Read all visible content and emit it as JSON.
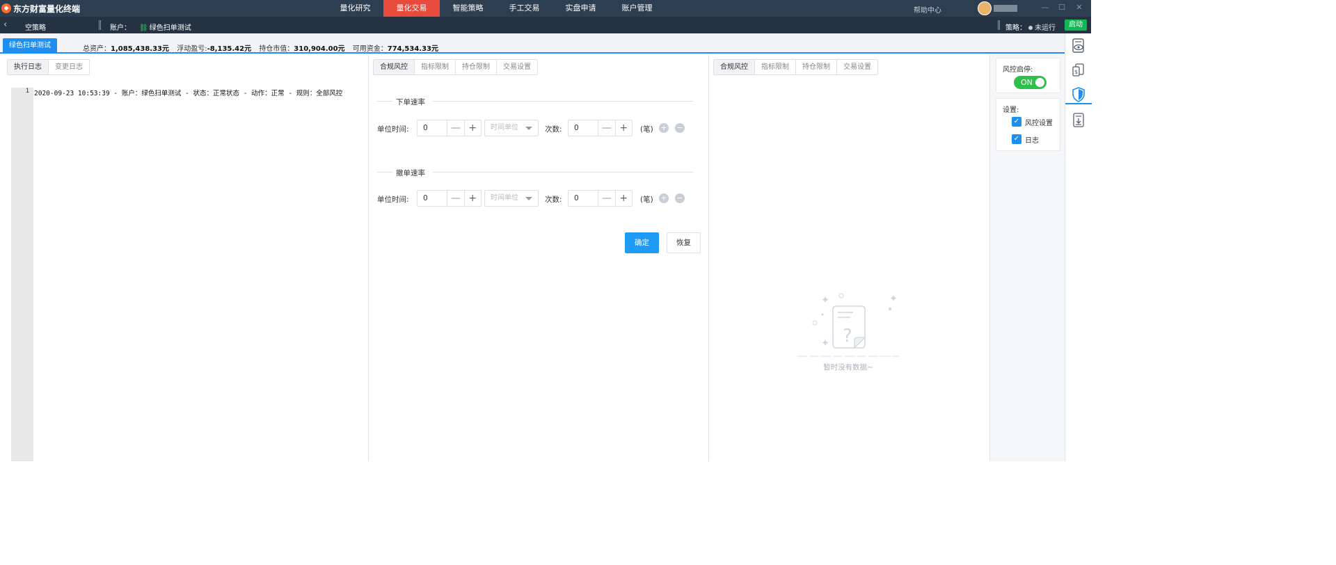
{
  "app": {
    "title": "东方财富量化终端"
  },
  "nav": {
    "items": [
      "量化研究",
      "量化交易",
      "智能策略",
      "手工交易",
      "实盘申请",
      "账户管理"
    ],
    "active": "量化交易",
    "help": "帮助中心"
  },
  "window": {
    "minimize": "—",
    "maximize": "☐",
    "close": "✕"
  },
  "subbar": {
    "strategy_name": "空策略",
    "account_label": "账户：",
    "account_name": "绿色扫单测试",
    "strategy_label": "策略：",
    "status": "未运行",
    "start_button": "启动"
  },
  "account_tab": {
    "label": "绿色扫单测试"
  },
  "summary": {
    "total_assets_label": "总资产：",
    "total_assets": "1,085,438.33元",
    "floating_pnl_label": "浮动盈亏:",
    "floating_pnl": "-8,135.42元",
    "position_value_label": "持仓市值：",
    "position_value": "310,904.00元",
    "available_funds_label": "可用资金：",
    "available_funds": "774,534.33元"
  },
  "log_panel": {
    "tabs": [
      "执行日志",
      "变更日志"
    ],
    "lines": [
      {
        "num": "1",
        "text": "2020-09-23 10:53:39 - 账户：绿色扫单测试 - 状态：正常状态 - 动作：正常 - 规则：全部风控"
      }
    ]
  },
  "risk_panel": {
    "tabs": [
      "合规风控",
      "指标限制",
      "持仓限制",
      "交易设置"
    ],
    "order_rate": {
      "title": "下单速率",
      "unit_time_label": "单位时间:",
      "unit_time_value": "0",
      "time_unit_placeholder": "时间单位",
      "count_label": "次数:",
      "count_value": "0",
      "count_unit": "(笔)"
    },
    "cancel_rate": {
      "title": "撤单速率",
      "unit_time_label": "单位时间:",
      "unit_time_value": "0",
      "time_unit_placeholder": "时间单位",
      "count_label": "次数:",
      "count_value": "0",
      "count_unit": "(笔)"
    },
    "stepper": {
      "minus": "—",
      "plus": "+",
      "add": "+",
      "remove": "−"
    },
    "confirm_button": "确定",
    "reset_button": "恢复"
  },
  "preview_panel": {
    "tabs": [
      "合规风控",
      "指标限制",
      "持仓限制",
      "交易设置"
    ],
    "empty_text": "暂时没有数据~"
  },
  "settings_panel": {
    "risk_toggle_label": "风控启停:",
    "risk_toggle_state": "ON",
    "settings_label": "设置:",
    "checkboxes": [
      {
        "label": "风控设置",
        "checked": true
      },
      {
        "label": "日志",
        "checked": true
      }
    ]
  },
  "colors": {
    "nav_bg": "#2d3e50",
    "nav_active": "#e84a3b",
    "accent": "#1f8ef1",
    "start_green": "#12b854",
    "toggle_green": "#2fc04b"
  }
}
